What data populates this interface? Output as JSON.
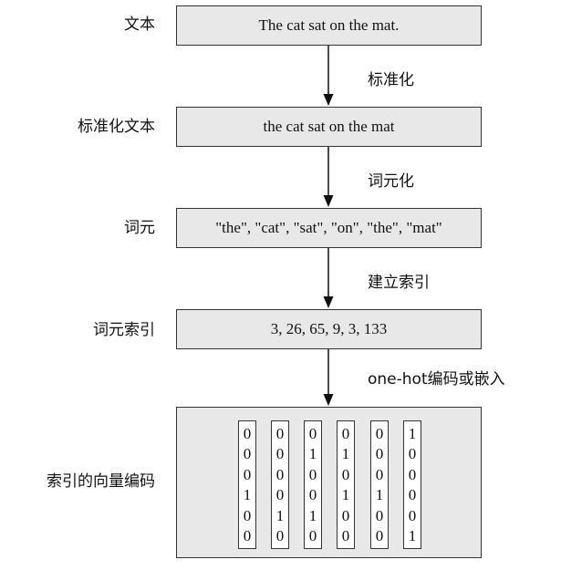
{
  "stages": [
    {
      "label": "文本",
      "content": "The cat sat on the mat."
    },
    {
      "label": "标准化文本",
      "content": "the cat sat on the mat"
    },
    {
      "label": "词元",
      "content": "\"the\", \"cat\", \"sat\", \"on\", \"the\", \"mat\""
    },
    {
      "label": "词元索引",
      "content": "3, 26, 65, 9, 3, 133"
    },
    {
      "label": "索引的向量编码"
    }
  ],
  "operations": [
    "标准化",
    "词元化",
    "建立索引",
    "one-hot编码或嵌入"
  ],
  "vectors": [
    [
      "0",
      "0",
      "0",
      "1",
      "0",
      "0"
    ],
    [
      "0",
      "0",
      "0",
      "0",
      "1",
      "0"
    ],
    [
      "0",
      "1",
      "0",
      "0",
      "1",
      "0"
    ],
    [
      "0",
      "1",
      "0",
      "1",
      "0",
      "0"
    ],
    [
      "0",
      "0",
      "0",
      "1",
      "0",
      "0"
    ],
    [
      "1",
      "0",
      "0",
      "0",
      "0",
      "1"
    ]
  ],
  "colors": {
    "box_fill": "#e8e8e8",
    "stroke": "#333333",
    "vector_fill": "#ffffff"
  }
}
